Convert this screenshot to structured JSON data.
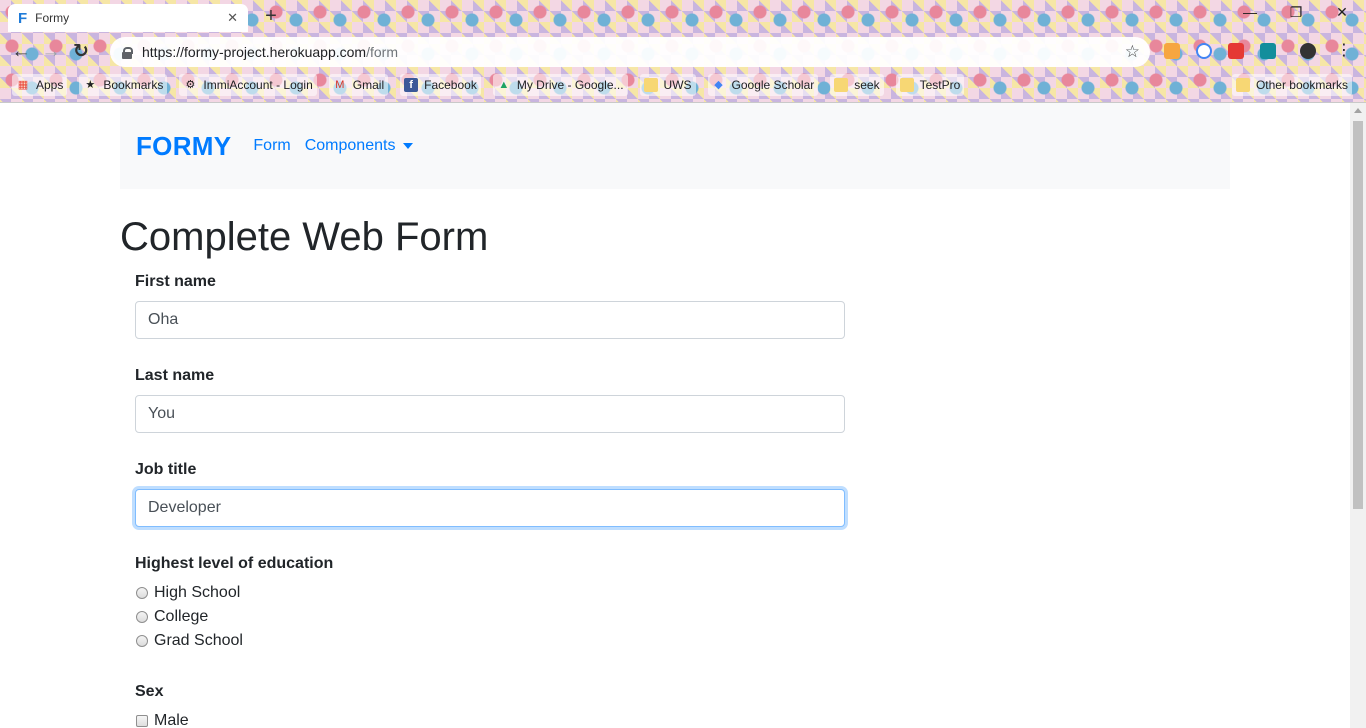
{
  "browser": {
    "tab_title": "Formy",
    "tab_favicon": "F",
    "new_tab_symbol": "+",
    "url_host": "https://formy-project.herokuapp.com",
    "url_path": "/form",
    "bookmarks": [
      {
        "label": "Apps",
        "icon": "apps-grid-icon",
        "color": "#ea4335"
      },
      {
        "label": "Bookmarks",
        "icon": "star-icon",
        "color": "#202124"
      },
      {
        "label": "ImmiAccount - Login",
        "icon": "gear-icon",
        "color": "#1a1a1a"
      },
      {
        "label": "Gmail",
        "icon": "gmail-icon",
        "color": "#d93025"
      },
      {
        "label": "Facebook",
        "icon": "facebook-icon",
        "color": "#3b5998"
      },
      {
        "label": "My Drive - Google...",
        "icon": "drive-icon",
        "color": "#1fa463"
      },
      {
        "label": "UWS",
        "icon": "folder-icon",
        "color": "#f7d774"
      },
      {
        "label": "Google Scholar",
        "icon": "scholar-icon",
        "color": "#4285f4"
      },
      {
        "label": "seek",
        "icon": "folder-icon",
        "color": "#f7d774"
      },
      {
        "label": "TestPro",
        "icon": "folder-icon",
        "color": "#f7d774"
      }
    ],
    "other_bookmarks": "Other bookmarks"
  },
  "navbar": {
    "brand": "FORMY",
    "links": [
      {
        "label": "Form"
      },
      {
        "label": "Components"
      }
    ]
  },
  "page": {
    "title": "Complete Web Form",
    "first_name": {
      "label": "First name",
      "value": "Oha"
    },
    "last_name": {
      "label": "Last name",
      "value": "You"
    },
    "job_title": {
      "label": "Job title",
      "value": "Developer"
    },
    "education": {
      "label": "Highest level of education",
      "options": [
        "High School",
        "College",
        "Grad School"
      ]
    },
    "sex": {
      "label": "Sex",
      "options": [
        "Male"
      ]
    }
  },
  "colors": {
    "brand": "#007bff",
    "navbar_bg": "#f8f9fa",
    "focus_ring": "#80bdff"
  }
}
